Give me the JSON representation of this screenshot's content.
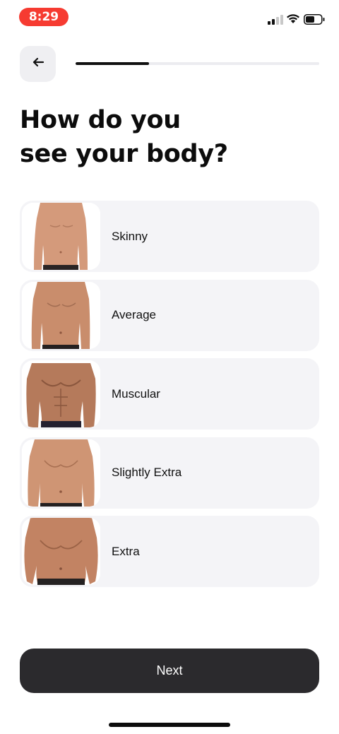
{
  "status_bar": {
    "time": "8:29",
    "time_pill_color": "#f63b31",
    "icons": [
      "cellular-signal-icon",
      "wifi-icon",
      "battery-icon"
    ]
  },
  "header": {
    "back_icon": "arrow-left-icon",
    "progress_fraction": 0.3
  },
  "question": {
    "title": "How do you see your body?"
  },
  "options": [
    {
      "label": "Skinny",
      "image": "skinny-torso-photo"
    },
    {
      "label": "Average",
      "image": "average-torso-photo"
    },
    {
      "label": "Muscular",
      "image": "muscular-torso-photo"
    },
    {
      "label": "Slightly Extra",
      "image": "slightly-extra-torso-photo"
    },
    {
      "label": "Extra",
      "image": "extra-torso-photo"
    }
  ],
  "footer": {
    "next_label": "Next"
  },
  "colors": {
    "accent_dark": "#2b2a2d",
    "option_background": "#f4f4f7",
    "skin_tone": "#c98d6c"
  }
}
